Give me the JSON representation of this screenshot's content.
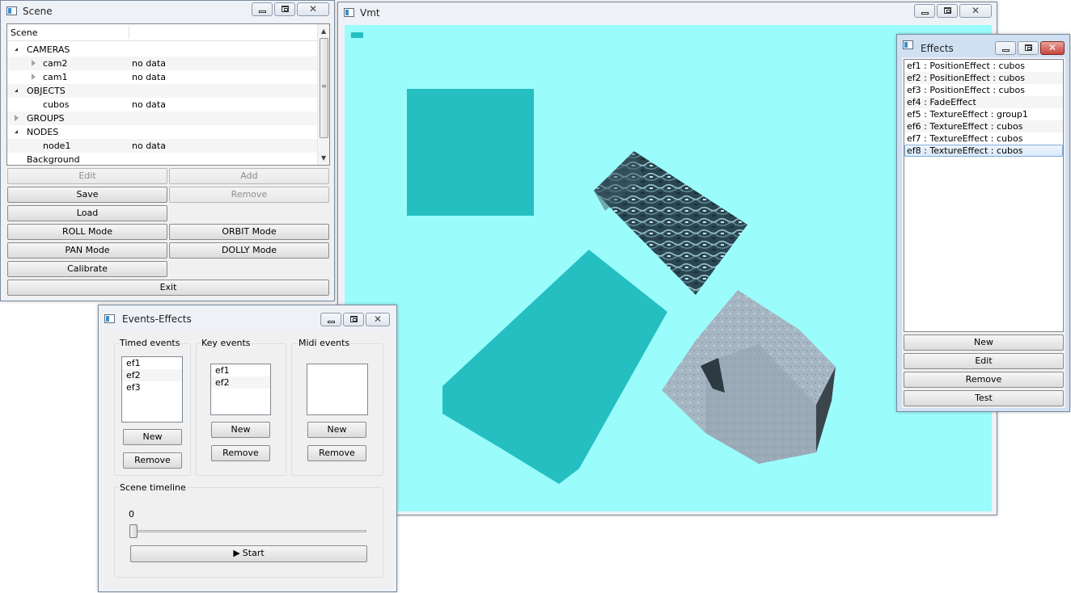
{
  "scene_window": {
    "title": "Scene",
    "tree_header": "Scene",
    "tree_rows": [
      {
        "label": "CAMERAS",
        "value": ""
      },
      {
        "label": "cam2",
        "value": "no data"
      },
      {
        "label": "cam1",
        "value": "no data"
      },
      {
        "label": "OBJECTS",
        "value": ""
      },
      {
        "label": "cubos",
        "value": "no data"
      },
      {
        "label": "GROUPS",
        "value": ""
      },
      {
        "label": "NODES",
        "value": ""
      },
      {
        "label": "node1",
        "value": "no data"
      },
      {
        "label": "Background",
        "value": ""
      }
    ],
    "buttons": {
      "edit": "Edit",
      "add": "Add",
      "save": "Save",
      "remove": "Remove",
      "load": "Load",
      "roll": "ROLL Mode",
      "orbit": "ORBIT Mode",
      "pan": "PAN Mode",
      "dolly": "DOLLY Mode",
      "calibrate": "Calibrate",
      "exit": "Exit"
    }
  },
  "vmt_window": {
    "title": "Vmt",
    "viewport_bg": "#9bfcfc",
    "flat_face_color": "#25bfc2"
  },
  "effects_window": {
    "title": "Effects",
    "items": [
      "ef1 : PositionEffect : cubos",
      "ef2 : PositionEffect : cubos",
      "ef3 : PositionEffect : cubos",
      "ef4 : FadeEffect",
      "ef5 : TextureEffect : group1",
      "ef6 : TextureEffect : cubos",
      "ef7 : TextureEffect : cubos",
      "ef8 : TextureEffect : cubos"
    ],
    "selected_index": 7,
    "buttons": {
      "new": "New",
      "edit": "Edit",
      "remove": "Remove",
      "test": "Test"
    }
  },
  "events_window": {
    "title": "Events-Effects",
    "timed": {
      "label": "Timed events",
      "items": [
        "ef1",
        "ef2",
        "ef3"
      ],
      "new": "New",
      "remove": "Remove"
    },
    "key": {
      "label": "Key events",
      "items": [
        "ef1",
        "ef2"
      ],
      "new": "New",
      "remove": "Remove"
    },
    "midi": {
      "label": "Midi events",
      "items": [],
      "new": "New",
      "remove": "Remove"
    },
    "timeline": {
      "label": "Scene timeline",
      "value_text": "0",
      "slider_value": 0,
      "start": "Start"
    }
  }
}
